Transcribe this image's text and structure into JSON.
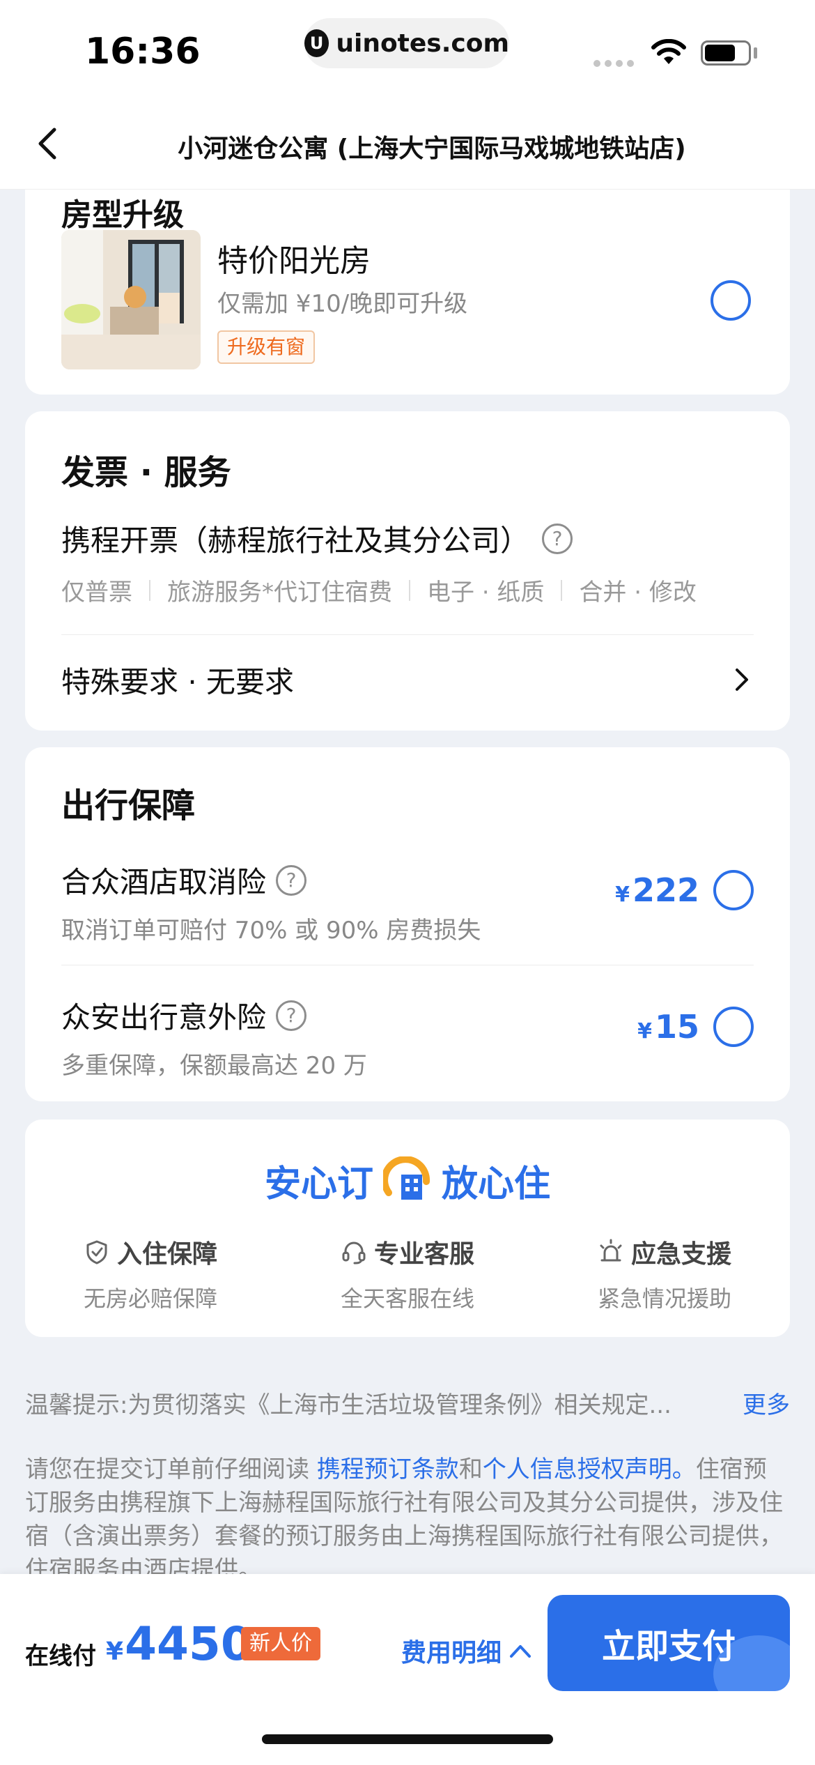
{
  "status_bar": {
    "time": "16:36",
    "url": "uinotes.com"
  },
  "nav": {
    "title": "小河迷仓公寓 (上海大宁国际马戏城地铁站店)"
  },
  "upgrade": {
    "heading": "房型升级",
    "room_name": "特价阳光房",
    "room_desc": "仅需加 ¥10/晚即可升级",
    "tag": "升级有窗"
  },
  "invoice": {
    "title": "发票 · 服务",
    "row_label": "携程开票（赫程旅行社及其分公司）",
    "tags": [
      "仅普票",
      "旅游服务*代订住宿费",
      "电子 · 纸质",
      "合并 · 修改"
    ],
    "special_label": "特殊要求 · 无要求"
  },
  "insurance": {
    "title": "出行保障",
    "items": [
      {
        "name": "合众酒店取消险",
        "desc": "取消订单可赔付 70% 或 90% 房费损失",
        "currency": "¥",
        "price": "222"
      },
      {
        "name": "众安出行意外险",
        "desc": "多重保障，保额最高达 20 万",
        "currency": "¥",
        "price": "15"
      }
    ]
  },
  "assurance": {
    "left_text": "安心订",
    "right_text": "放心住",
    "features": [
      {
        "icon": "shield-check-icon",
        "title": "入住保障",
        "desc": "无房必赔保障"
      },
      {
        "icon": "headset-icon",
        "title": "专业客服",
        "desc": "全天客服在线"
      },
      {
        "icon": "alarm-light-icon",
        "title": "应急支援",
        "desc": "紧急情况援助"
      }
    ]
  },
  "tips": {
    "text": "温馨提示:为贯彻落实《上海市生活垃圾管理条例》相关规定...",
    "more": "更多"
  },
  "terms": {
    "prefix": "请您在提交订单前仔细阅读 ",
    "link1": "携程预订条款",
    "mid": "和",
    "link2": "个人信息授权声明。",
    "suffix": "住宿预订服务由携程旗下上海赫程国际旅行社有限公司及其分公司提供，涉及住宿（含演出票务）套餐的预订服务由上海携程国际旅行社有限公司提供，住宿服务由酒店提供。"
  },
  "bottom_bar": {
    "pay_label": "在线付",
    "currency": "¥",
    "amount": "4450",
    "newbie_tag": "新人价",
    "fee_detail": "费用明细",
    "pay_button": "立即支付"
  },
  "colors": {
    "accent": "#2b6fe8",
    "tag_orange": "#ee6a3a",
    "background": "#eef1f6"
  }
}
